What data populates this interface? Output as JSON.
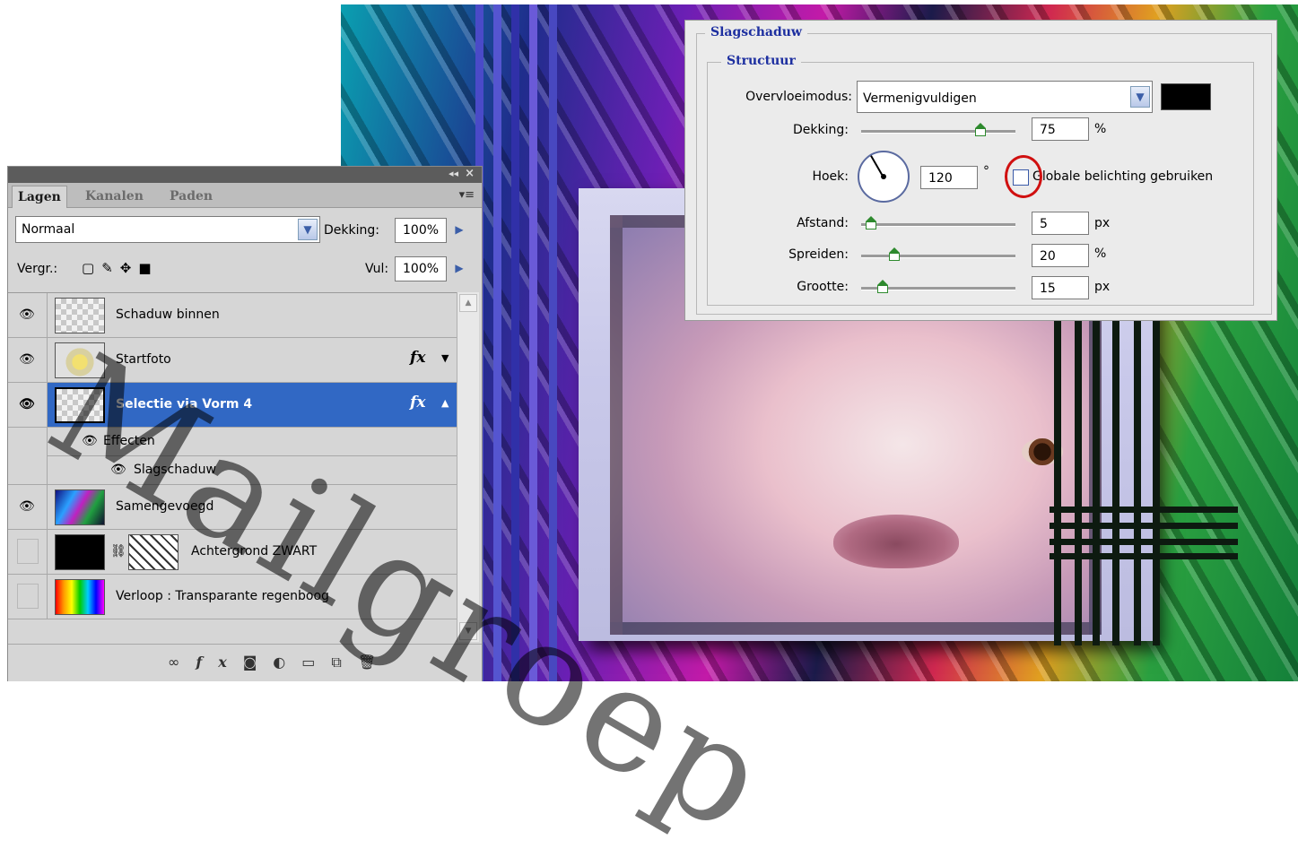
{
  "layers_panel": {
    "tabs": [
      {
        "label": "Lagen",
        "active": true
      },
      {
        "label": "Kanalen",
        "active": false
      },
      {
        "label": "Paden",
        "active": false
      }
    ],
    "collapse_glyph": "◂◂",
    "close_glyph": "×",
    "menu_icon": "panel-menu-icon",
    "blend_mode": "Normaal",
    "opacity_label": "Dekking:",
    "opacity_value": "100%",
    "lock_label": "Vergr.:",
    "lock_icons": [
      "lock-transparency-icon",
      "lock-brush-icon",
      "lock-move-icon",
      "lock-all-icon"
    ],
    "fill_label": "Vul:",
    "fill_value": "100%",
    "layers": [
      {
        "name": "Schaduw binnen",
        "visible": true,
        "fx": false,
        "selected": false
      },
      {
        "name": "Startfoto",
        "visible": true,
        "fx": true,
        "selected": false
      },
      {
        "name": "Selectie via Vorm 4",
        "visible": true,
        "fx": true,
        "selected": true
      },
      {
        "name": "Samengevoegd",
        "visible": true,
        "fx": false,
        "selected": false
      },
      {
        "name": "Achtergrond ZWART",
        "visible": false,
        "fx": false,
        "selected": false
      },
      {
        "name": "Verloop : Transparante regenboog",
        "visible": false,
        "fx": false,
        "selected": false
      }
    ],
    "effects": {
      "label": "Effecten",
      "items": [
        "Slagschaduw"
      ]
    },
    "fx_label": "fx",
    "bottom_icons": [
      "link-icon",
      "fx-icon",
      "mask-icon",
      "adjustment-icon",
      "folder-icon",
      "new-layer-icon",
      "trash-icon"
    ]
  },
  "dialog": {
    "title": "Slagschaduw",
    "group": "Structuur",
    "blend_label": "Overvloeimodus:",
    "blend_value": "Vermenigvuldigen",
    "shadow_color": "#000000",
    "opacity_label": "Dekking:",
    "opacity_value": "75",
    "opacity_unit": "%",
    "angle_label": "Hoek:",
    "angle_value": "120",
    "angle_unit": "°",
    "global_light_label": "Globale belichting gebruiken",
    "global_light_checked": false,
    "distance_label": "Afstand:",
    "distance_value": "5",
    "distance_unit": "px",
    "spread_label": "Spreiden:",
    "spread_value": "20",
    "spread_unit": "%",
    "size_label": "Grootte:",
    "size_value": "15",
    "size_unit": "px"
  },
  "watermark": "Mailgroep"
}
